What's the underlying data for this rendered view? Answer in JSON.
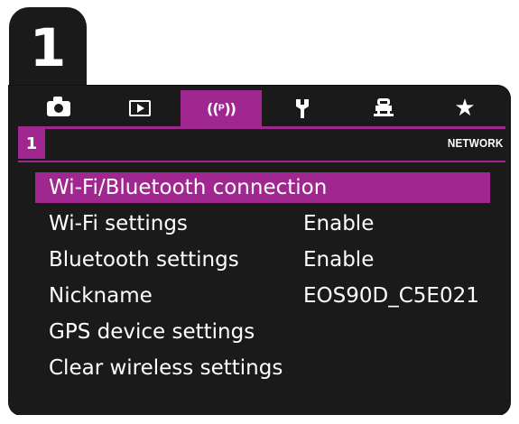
{
  "step": {
    "number": "1"
  },
  "tabs": [
    {
      "icon": "camera-icon",
      "active": false
    },
    {
      "icon": "playback-icon",
      "active": false
    },
    {
      "icon": "wireless-icon",
      "label": "((ᵖ))",
      "active": true
    },
    {
      "icon": "wrench-icon",
      "active": false
    },
    {
      "icon": "custom-function-icon",
      "active": false
    },
    {
      "icon": "star-icon",
      "active": false
    }
  ],
  "header": {
    "page": "1",
    "section": "NETWORK"
  },
  "menu": {
    "items": [
      {
        "label": "Wi-Fi/Bluetooth connection",
        "value": ""
      },
      {
        "label": "Wi-Fi settings",
        "value": "Enable"
      },
      {
        "label": "Bluetooth settings",
        "value": "Enable"
      },
      {
        "label": "Nickname",
        "value": "EOS90D_C5E021"
      },
      {
        "label": "GPS device settings",
        "value": ""
      },
      {
        "label": "Clear wireless settings",
        "value": ""
      }
    ],
    "selected_index": 0
  },
  "colors": {
    "accent": "#a0278f",
    "background": "#1a1a1a",
    "text": "#ffffff"
  }
}
